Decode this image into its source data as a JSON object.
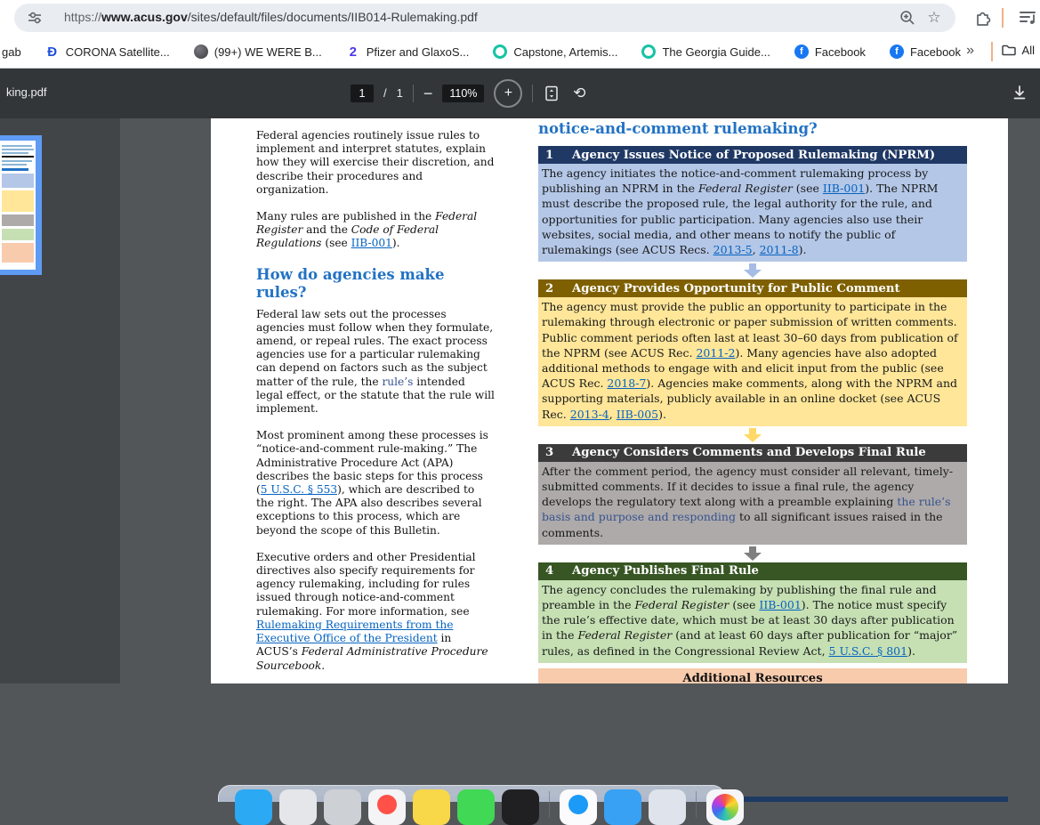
{
  "browser": {
    "url": {
      "scheme": "https://",
      "host": "www.acus.gov",
      "path": "/sites/default/files/documents/IIB014-Rulemaking.pdf"
    },
    "bookmarks_bar": {
      "items": [
        {
          "label": "gab",
          "icon": "none"
        },
        {
          "label": "CORONA Satellite...",
          "icon": "letter",
          "glyph": "Đ",
          "color": "#1d4fd7"
        },
        {
          "label": "(99+) WE WERE B...",
          "icon": "dark"
        },
        {
          "label": "Pfizer and GlaxoS...",
          "icon": "letter",
          "glyph": "2",
          "color": "#4b38e8"
        },
        {
          "label": "Capstone, Artemis...",
          "icon": "ring",
          "color": "#17c3a4"
        },
        {
          "label": "The Georgia Guide...",
          "icon": "ring",
          "color": "#17c3a4"
        },
        {
          "label": "Facebook",
          "icon": "disc",
          "glyph": "f",
          "color": "#1877f2"
        },
        {
          "label": "Facebook",
          "icon": "disc",
          "glyph": "f",
          "color": "#1877f2"
        }
      ],
      "overflow_chevron": "»",
      "all_bookmarks_label": "All"
    }
  },
  "pdf_toolbar": {
    "filename": "king.pdf",
    "page_current": "1",
    "page_separator": "/",
    "page_total": "1",
    "zoom_out_glyph": "−",
    "zoom_level": "110%",
    "zoom_in_glyph": "+",
    "rotate_glyph": "⟲"
  },
  "document": {
    "left_column": {
      "paragraph1": [
        {
          "k": "t",
          "s": "Federal agencies routinely issue rules to implement and interpret statutes, explain how they will exercise their discretion, and describe their procedures and organization."
        }
      ],
      "paragraph2": [
        {
          "k": "t",
          "s": "Many rules are published in the "
        },
        {
          "k": "i",
          "s": "Federal Register"
        },
        {
          "k": "t",
          "s": " and the "
        },
        {
          "k": "i",
          "s": "Code of Federal Regulations"
        },
        {
          "k": "t",
          "s": " (see "
        },
        {
          "k": "a",
          "s": "IIB-001"
        },
        {
          "k": "t",
          "s": ")."
        }
      ],
      "heading": "How do agencies make rules?",
      "paragraph3": [
        {
          "k": "t",
          "s": "Federal law sets out the processes agencies must follow when they formulate, amend, or repeal rules. The exact process agencies use for a particular rulemaking can depend on factors such as the subject matter of the rule, the "
        },
        {
          "k": "hl",
          "s": "rule’s"
        },
        {
          "k": "t",
          "s": " intended legal effect, or the statute that the rule will implement."
        }
      ],
      "paragraph4": [
        {
          "k": "t",
          "s": "Most prominent among these processes is “notice-and-comment rule-making.” The Administrative Procedure Act (APA) describes the basic steps for this process ("
        },
        {
          "k": "a",
          "s": "5 U.S.C. § 553"
        },
        {
          "k": "t",
          "s": "), which are described to the right. The APA also describes several exceptions to this process, which are beyond the scope of this Bulletin."
        }
      ],
      "paragraph5": [
        {
          "k": "t",
          "s": "Executive orders and other Presidential directives also specify requirements for agency rulemaking, including for rules issued through notice-and-comment rulemaking. For more information, see "
        },
        {
          "k": "a",
          "s": "Rulemaking Requirements from the Executive Office of the President"
        },
        {
          "k": "t",
          "s": " in ACUS’s "
        },
        {
          "k": "i",
          "s": "Federal Administrative Procedure Sourcebook"
        },
        {
          "k": "t",
          "s": "."
        }
      ]
    },
    "right_column": {
      "heading_fragment": "notice-and-comment rulemaking?",
      "steps": [
        {
          "number": "1",
          "title": "Agency Issues Notice of Proposed Rulemaking (NPRM)",
          "header_color": "#1f3864",
          "body_color": "#b4c7e7",
          "arrow_color": "#a6bce4",
          "body": [
            {
              "k": "t",
              "s": "The agency initiates the notice-and-comment rulemaking process by publishing an NPRM in the "
            },
            {
              "k": "i",
              "s": "Federal Register"
            },
            {
              "k": "t",
              "s": " (see "
            },
            {
              "k": "a",
              "s": "IIB-001"
            },
            {
              "k": "t",
              "s": "). The NPRM must describe the proposed rule, the legal authority for the rule, and opportunities for public participation. Many agencies also use their websites, social media, and other means to notify the public of rulemakings (see ACUS Recs. "
            },
            {
              "k": "a",
              "s": "2013-5"
            },
            {
              "k": "t",
              "s": ", "
            },
            {
              "k": "a",
              "s": "2011-8"
            },
            {
              "k": "t",
              "s": ")."
            }
          ]
        },
        {
          "number": "2",
          "title": "Agency Provides Opportunity for Public Comment",
          "header_color": "#7f6000",
          "body_color": "#ffe699",
          "arrow_color": "#ffd966",
          "body": [
            {
              "k": "t",
              "s": "The agency must provide the public an opportunity to participate in the rulemaking through electronic or paper submission of written comments. Public comment periods often last at least 30–60 days from publication of the NPRM (see ACUS Rec. "
            },
            {
              "k": "a",
              "s": "2011-2"
            },
            {
              "k": "t",
              "s": "). Many agencies have also adopted additional methods to engage with and elicit input from the public (see ACUS Rec. "
            },
            {
              "k": "a",
              "s": "2018-7"
            },
            {
              "k": "t",
              "s": "). Agencies make comments, along with the NPRM and supporting materials, publicly available in an online docket (see ACUS Rec. "
            },
            {
              "k": "a",
              "s": "2013-4"
            },
            {
              "k": "t",
              "s": ", "
            },
            {
              "k": "a",
              "s": "IIB-005"
            },
            {
              "k": "t",
              "s": ")."
            }
          ]
        },
        {
          "number": "3",
          "title": "Agency Considers Comments and Develops Final Rule",
          "header_color": "#3b3b3b",
          "body_color": "#aeaaaa",
          "arrow_color": "#7f7f7f",
          "body": [
            {
              "k": "t",
              "s": "After the comment period, the agency must consider all relevant, timely-submitted comments. If it decides to issue a final rule, the agency develops the regulatory text along with a preamble explaining "
            },
            {
              "k": "hl",
              "s": "the rule’s basis and purpose and responding"
            },
            {
              "k": "t",
              "s": " to all significant issues raised in the comments."
            }
          ]
        },
        {
          "number": "4",
          "title": "Agency Publishes Final Rule",
          "header_color": "#375623",
          "body_color": "#c6e0b4",
          "arrow_color": "",
          "body": [
            {
              "k": "t",
              "s": "The agency concludes the rulemaking by publishing the final rule and preamble in the "
            },
            {
              "k": "i",
              "s": "Federal Register"
            },
            {
              "k": "t",
              "s": " (see "
            },
            {
              "k": "a",
              "s": "IIB-001"
            },
            {
              "k": "t",
              "s": "). The notice must specify the rule’s effective date, which must be at least 30 days after publication in the "
            },
            {
              "k": "i",
              "s": "Federal Register"
            },
            {
              "k": "t",
              "s": " (and at least 60 days after publication for “major” rules, as defined in the Congressional Review Act, "
            },
            {
              "k": "a",
              "s": "5 U.S.C. § 801"
            },
            {
              "k": "t",
              "s": ")."
            }
          ]
        }
      ],
      "additional_resources": {
        "title": "Additional Resources",
        "bg_color": "#f8cbad"
      }
    }
  },
  "dock": {
    "icons": [
      {
        "name": "finder-icon",
        "color": "#2ba9f3"
      },
      {
        "name": "app-light-gray-icon",
        "color": "#e4e6ea"
      },
      {
        "name": "app-silver-icon",
        "color": "#cdd0d5"
      },
      {
        "name": "music-icon",
        "color": "#f4f4f6",
        "accent": "#ff5147"
      },
      {
        "name": "notes-icon",
        "color": "#f8d748"
      },
      {
        "name": "messages-icon",
        "color": "#40d854"
      },
      {
        "name": "app-black-icon",
        "color": "#202022"
      },
      {
        "name": "separator"
      },
      {
        "name": "appstore-icon",
        "color": "#fbfbfd",
        "accent": "#1b9af7"
      },
      {
        "name": "mail-icon",
        "color": "#38a1f4"
      },
      {
        "name": "app-pale-icon",
        "color": "#dfe3eb"
      },
      {
        "name": "separator"
      },
      {
        "name": "photos-icon",
        "color": "pinwheel"
      }
    ]
  }
}
